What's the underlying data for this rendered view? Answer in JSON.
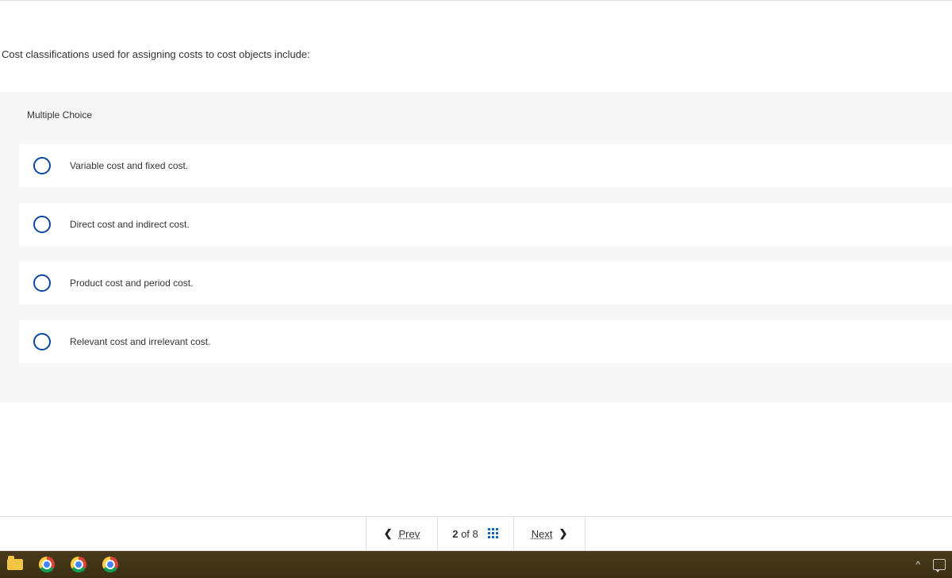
{
  "question": "Cost classifications used for assigning costs to cost objects include:",
  "question_type_label": "Multiple Choice",
  "options": [
    "Variable cost and fixed cost.",
    "Direct cost and indirect cost.",
    "Product cost and period cost.",
    "Relevant cost and irrelevant cost."
  ],
  "pager": {
    "prev_label": "Prev",
    "next_label": "Next",
    "current": "2",
    "of_word": "of",
    "total": "8"
  }
}
